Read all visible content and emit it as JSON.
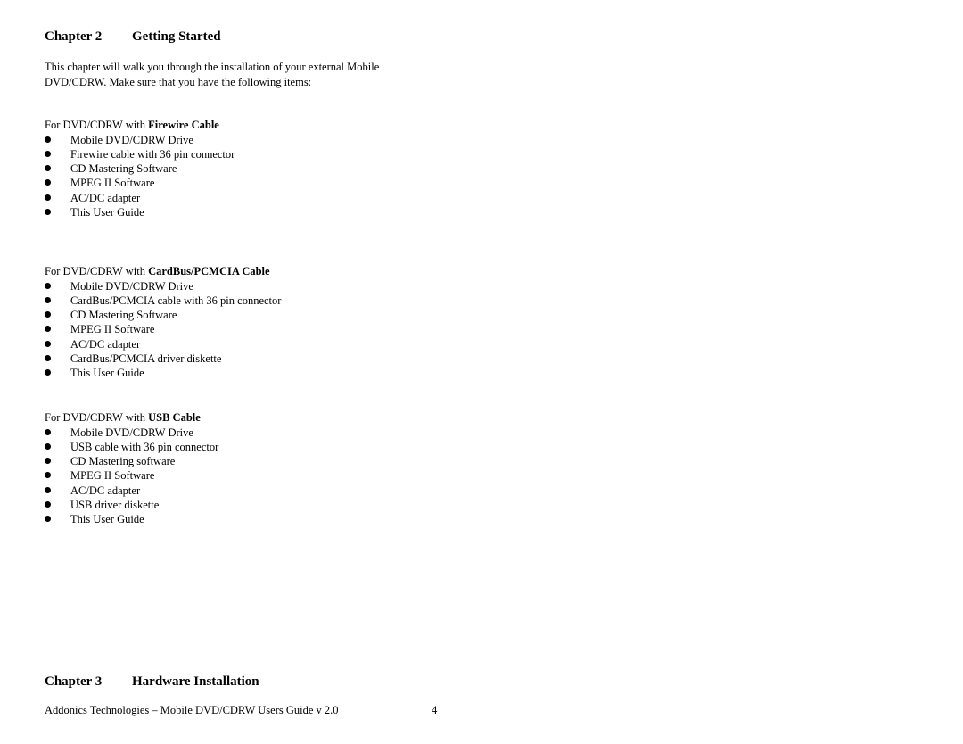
{
  "chapter2": {
    "number": "Chapter 2",
    "title": "Getting Started",
    "intro_line1": "This chapter will walk you through the installation of your external Mobile",
    "intro_line2": "DVD/CDRW. Make sure that you have the following items:"
  },
  "sections": [
    {
      "prefix": "For DVD/CDRW with ",
      "cable": "Firewire Cable",
      "items": [
        "Mobile DVD/CDRW Drive",
        "Firewire cable with 36 pin connector",
        "CD Mastering Software",
        "MPEG II Software",
        "AC/DC adapter",
        "This User Guide"
      ]
    },
    {
      "prefix": "For DVD/CDRW with ",
      "cable": "CardBus/PCMCIA Cable",
      "items": [
        "Mobile DVD/CDRW Drive",
        "CardBus/PCMCIA cable with 36 pin connector",
        "CD Mastering Software",
        "MPEG II Software",
        "AC/DC adapter",
        "CardBus/PCMCIA driver diskette",
        "This User Guide"
      ]
    },
    {
      "prefix": "For DVD/CDRW with ",
      "cable": "USB Cable",
      "items": [
        "Mobile DVD/CDRW Drive",
        "USB cable with 36 pin connector",
        "CD Mastering software",
        "MPEG II Software",
        "AC/DC adapter",
        "USB driver diskette",
        "This User Guide"
      ]
    }
  ],
  "chapter3": {
    "number": "Chapter 3",
    "title": "Hardware Installation"
  },
  "footer": {
    "text": "Addonics Technologies – Mobile DVD/CDRW Users Guide v 2.0",
    "page_number": "4"
  }
}
